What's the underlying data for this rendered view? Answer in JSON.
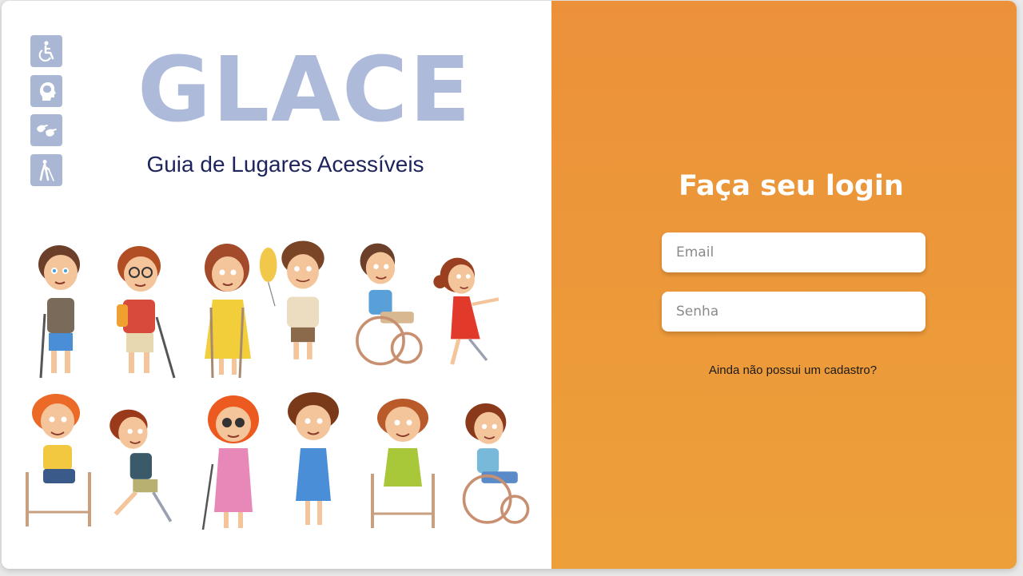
{
  "brand": {
    "title": "GLACE",
    "subtitle": "Guia de Lugares Acessíveis"
  },
  "accessibility_icons": [
    {
      "name": "wheelchair-icon"
    },
    {
      "name": "cognitive-head-icon"
    },
    {
      "name": "sign-language-icon"
    },
    {
      "name": "blind-cane-icon"
    }
  ],
  "login": {
    "title": "Faça seu login",
    "email_placeholder": "Email",
    "password_placeholder": "Senha",
    "signup_link": "Ainda não possui um cadastro?"
  },
  "colors": {
    "accent_orange": "#ec913a",
    "logo_blue": "#aebad9",
    "subtitle_navy": "#1d245c",
    "icon_blue": "#a9b7d4"
  }
}
